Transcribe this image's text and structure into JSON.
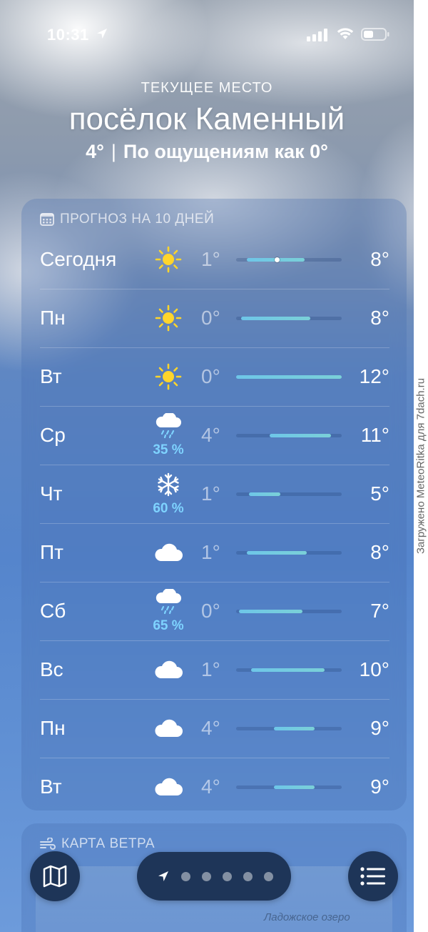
{
  "status_bar": {
    "time": "10:31"
  },
  "location": {
    "label": "ТЕКУЩЕЕ МЕСТО",
    "name": "посёлок Каменный",
    "current_temp": "4°",
    "feels_like": "По ощущениям как 0°"
  },
  "forecast": {
    "title": "ПРОГНОЗ НА 10 ДНЕЙ",
    "days": [
      {
        "day": "Сегодня",
        "icon": "sun-icon",
        "precip": "",
        "low": "1°",
        "high": "8°",
        "range_start": 0.1,
        "range_end": 0.65,
        "current": 0.39
      },
      {
        "day": "Пн",
        "icon": "sun-icon",
        "precip": "",
        "low": "0°",
        "high": "8°",
        "range_start": 0.05,
        "range_end": 0.7
      },
      {
        "day": "Вт",
        "icon": "sun-icon",
        "precip": "",
        "low": "0°",
        "high": "12°",
        "range_start": 0.0,
        "range_end": 1.0
      },
      {
        "day": "Ср",
        "icon": "cloud-rain-icon",
        "precip": "35 %",
        "low": "4°",
        "high": "11°",
        "range_start": 0.32,
        "range_end": 0.9
      },
      {
        "day": "Чт",
        "icon": "snowflake-icon",
        "precip": "60 %",
        "low": "1°",
        "high": "5°",
        "range_start": 0.12,
        "range_end": 0.42
      },
      {
        "day": "Пт",
        "icon": "cloud-icon",
        "precip": "",
        "low": "1°",
        "high": "8°",
        "range_start": 0.1,
        "range_end": 0.67
      },
      {
        "day": "Сб",
        "icon": "cloud-rain-icon",
        "precip": "65 %",
        "low": "0°",
        "high": "7°",
        "range_start": 0.03,
        "range_end": 0.63
      },
      {
        "day": "Вс",
        "icon": "cloud-icon",
        "precip": "",
        "low": "1°",
        "high": "10°",
        "range_start": 0.14,
        "range_end": 0.84
      },
      {
        "day": "Пн",
        "icon": "cloud-icon",
        "precip": "",
        "low": "4°",
        "high": "9°",
        "range_start": 0.36,
        "range_end": 0.74
      },
      {
        "day": "Вт",
        "icon": "cloud-icon",
        "precip": "",
        "low": "4°",
        "high": "9°",
        "range_start": 0.36,
        "range_end": 0.74
      }
    ]
  },
  "wind_map": {
    "title": "КАРТА ВЕТРА",
    "map_label": "Ладожское озеро"
  },
  "pager": {
    "pages": 6,
    "current": 0
  },
  "watermark": "Загружено MeteoRitka для 7dach.ru",
  "colors": {
    "bar": "#6ec6e8",
    "precip": "#7ed3ff",
    "button_bg": "#1e3558"
  }
}
